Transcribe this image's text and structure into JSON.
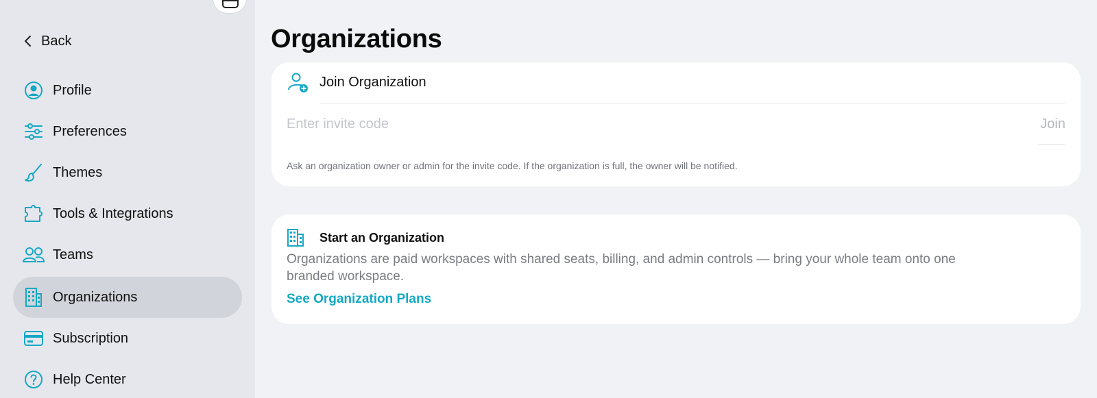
{
  "sidebar": {
    "back_label": "Back",
    "items": [
      {
        "id": "profile",
        "label": "Profile",
        "icon": "profile-icon",
        "active": false
      },
      {
        "id": "preferences",
        "label": "Preferences",
        "icon": "sliders-icon",
        "active": false
      },
      {
        "id": "themes",
        "label": "Themes",
        "icon": "paintbrush-icon",
        "active": false
      },
      {
        "id": "tools",
        "label": "Tools & Integrations",
        "icon": "puzzle-icon",
        "active": false
      },
      {
        "id": "teams",
        "label": "Teams",
        "icon": "people-icon",
        "active": false
      },
      {
        "id": "organizations",
        "label": "Organizations",
        "icon": "building-icon",
        "active": true
      },
      {
        "id": "subscription",
        "label": "Subscription",
        "icon": "credit-card-icon",
        "active": false
      },
      {
        "id": "help",
        "label": "Help Center",
        "icon": "question-circle-icon",
        "active": false
      }
    ]
  },
  "main": {
    "title": "Organizations",
    "join": {
      "title": "Join Organization",
      "placeholder": "Enter invite code",
      "button": "Join",
      "help": "Ask an organization owner or admin for the invite code. If the organization is full, the owner will be notified."
    },
    "start": {
      "title": "Start an Organization",
      "description": "Organizations are paid workspaces with shared seats, billing, and admin controls — bring your whole team onto one branded workspace.",
      "link": "See Organization Plans"
    }
  },
  "colors": {
    "accent": "#14a8c6",
    "sidebar_bg": "#e5e7ec",
    "page_bg": "#f1f2f6",
    "active_item_bg": "#d1d4da"
  }
}
